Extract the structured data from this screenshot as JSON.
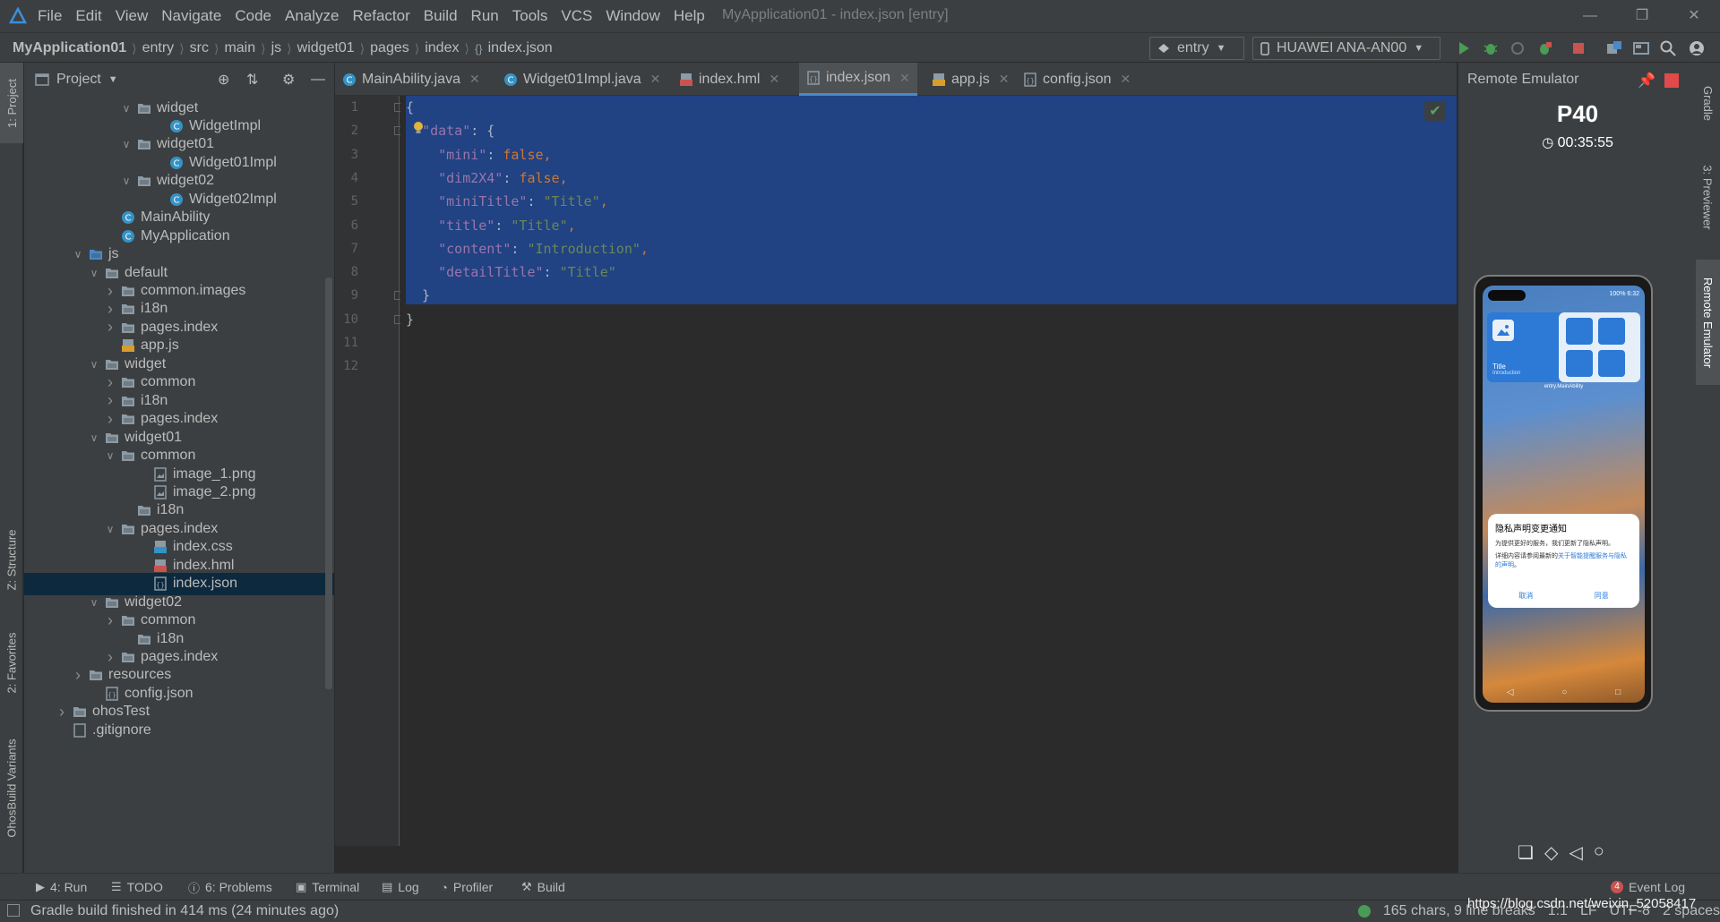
{
  "menubar": {
    "items": [
      "File",
      "Edit",
      "View",
      "Navigate",
      "Code",
      "Analyze",
      "Refactor",
      "Build",
      "Run",
      "Tools",
      "VCS",
      "Window",
      "Help"
    ],
    "window_title": "MyApplication01 - index.json [entry]"
  },
  "breadcrumb": [
    "MyApplication01",
    "entry",
    "src",
    "main",
    "js",
    "widget01",
    "pages",
    "index",
    "index.json"
  ],
  "toolbar": {
    "module_selector": "entry",
    "device_selector": "HUAWEI ANA-AN00"
  },
  "project_panel": {
    "title": "Project",
    "tree": [
      {
        "label": "widget",
        "level": 7,
        "type": "folder",
        "expanded": true
      },
      {
        "label": "WidgetImpl",
        "level": 9,
        "type": "class"
      },
      {
        "label": "widget01",
        "level": 7,
        "type": "folder",
        "expanded": true
      },
      {
        "label": "Widget01Impl",
        "level": 9,
        "type": "class"
      },
      {
        "label": "widget02",
        "level": 7,
        "type": "folder",
        "expanded": true
      },
      {
        "label": "Widget02Impl",
        "level": 9,
        "type": "class"
      },
      {
        "label": "MainAbility",
        "level": 6,
        "type": "class"
      },
      {
        "label": "MyApplication",
        "level": 6,
        "type": "class"
      },
      {
        "label": "js",
        "level": 4,
        "type": "folder-blue",
        "expanded": true
      },
      {
        "label": "default",
        "level": 5,
        "type": "folder",
        "expanded": true
      },
      {
        "label": "common.images",
        "level": 6,
        "type": "folder",
        "expanded": false
      },
      {
        "label": "i18n",
        "level": 6,
        "type": "folder",
        "expanded": false
      },
      {
        "label": "pages.index",
        "level": 6,
        "type": "folder",
        "expanded": false
      },
      {
        "label": "app.js",
        "level": 6,
        "type": "js"
      },
      {
        "label": "widget",
        "level": 5,
        "type": "folder",
        "expanded": true
      },
      {
        "label": "common",
        "level": 6,
        "type": "folder",
        "expanded": false
      },
      {
        "label": "i18n",
        "level": 6,
        "type": "folder",
        "expanded": false
      },
      {
        "label": "pages.index",
        "level": 6,
        "type": "folder",
        "expanded": false
      },
      {
        "label": "widget01",
        "level": 5,
        "type": "folder",
        "expanded": true
      },
      {
        "label": "common",
        "level": 6,
        "type": "folder",
        "expanded": true
      },
      {
        "label": "image_1.png",
        "level": 8,
        "type": "image"
      },
      {
        "label": "image_2.png",
        "level": 8,
        "type": "image"
      },
      {
        "label": "i18n",
        "level": 7,
        "type": "folder"
      },
      {
        "label": "pages.index",
        "level": 6,
        "type": "folder",
        "expanded": true
      },
      {
        "label": "index.css",
        "level": 8,
        "type": "css"
      },
      {
        "label": "index.hml",
        "level": 8,
        "type": "hml"
      },
      {
        "label": "index.json",
        "level": 8,
        "type": "json",
        "selected": true
      },
      {
        "label": "widget02",
        "level": 5,
        "type": "folder",
        "expanded": true
      },
      {
        "label": "common",
        "level": 6,
        "type": "folder",
        "expanded": false
      },
      {
        "label": "i18n",
        "level": 7,
        "type": "folder"
      },
      {
        "label": "pages.index",
        "level": 6,
        "type": "folder",
        "expanded": false
      },
      {
        "label": "resources",
        "level": 4,
        "type": "folder",
        "expanded": false
      },
      {
        "label": "config.json",
        "level": 5,
        "type": "json"
      },
      {
        "label": "ohosTest",
        "level": 3,
        "type": "folder",
        "expanded": false
      },
      {
        "label": ".gitignore",
        "level": 3,
        "type": "file"
      }
    ]
  },
  "editor_tabs": [
    {
      "label": "MainAbility.java",
      "icon": "class-icon",
      "active": false
    },
    {
      "label": "Widget01Impl.java",
      "icon": "class-icon",
      "active": false
    },
    {
      "label": "index.hml",
      "icon": "hml-icon",
      "active": false
    },
    {
      "label": "index.json",
      "icon": "json-icon",
      "active": true
    },
    {
      "label": "app.js",
      "icon": "js-icon",
      "active": false
    },
    {
      "label": "config.json",
      "icon": "json-icon",
      "active": false
    }
  ],
  "editor": {
    "line_numbers": [
      "1",
      "2",
      "3",
      "4",
      "5",
      "6",
      "7",
      "8",
      "9",
      "10",
      "11",
      "12"
    ],
    "lines": [
      [
        {
          "t": "{",
          "c": "p"
        }
      ],
      [
        {
          "t": "  ",
          "c": "p"
        },
        {
          "t": "\"data\"",
          "c": "k"
        },
        {
          "t": ": {",
          "c": "p"
        }
      ],
      [
        {
          "t": "    ",
          "c": "p"
        },
        {
          "t": "\"mini\"",
          "c": "k"
        },
        {
          "t": ": ",
          "c": "p"
        },
        {
          "t": "false",
          "c": "kw"
        },
        {
          "t": ",",
          "c": "kw"
        }
      ],
      [
        {
          "t": "    ",
          "c": "p"
        },
        {
          "t": "\"dim2X4\"",
          "c": "k"
        },
        {
          "t": ": ",
          "c": "p"
        },
        {
          "t": "false",
          "c": "kw"
        },
        {
          "t": ",",
          "c": "kw"
        }
      ],
      [
        {
          "t": "    ",
          "c": "p"
        },
        {
          "t": "\"miniTitle\"",
          "c": "k"
        },
        {
          "t": ": ",
          "c": "p"
        },
        {
          "t": "\"Title\"",
          "c": "s"
        },
        {
          "t": ",",
          "c": "kw"
        }
      ],
      [
        {
          "t": "    ",
          "c": "p"
        },
        {
          "t": "\"title\"",
          "c": "k"
        },
        {
          "t": ": ",
          "c": "p"
        },
        {
          "t": "\"Title\"",
          "c": "s"
        },
        {
          "t": ",",
          "c": "kw"
        }
      ],
      [
        {
          "t": "    ",
          "c": "p"
        },
        {
          "t": "\"content\"",
          "c": "k"
        },
        {
          "t": ": ",
          "c": "p"
        },
        {
          "t": "\"Introduction\"",
          "c": "s"
        },
        {
          "t": ",",
          "c": "kw"
        }
      ],
      [
        {
          "t": "    ",
          "c": "p"
        },
        {
          "t": "\"detailTitle\"",
          "c": "k"
        },
        {
          "t": ": ",
          "c": "p"
        },
        {
          "t": "\"Title\"",
          "c": "s"
        }
      ],
      [
        {
          "t": "  }",
          "c": "p"
        }
      ],
      [
        {
          "t": "}",
          "c": "p"
        }
      ],
      [],
      []
    ]
  },
  "remote_emulator": {
    "title": "Remote Emulator",
    "model": "P40",
    "timer": "00:35:55",
    "phone": {
      "status_right": "100% 6:32",
      "widget_title": "Title",
      "widget_subtitle": "Introduction",
      "widget_caption": "entry.MainAbility",
      "dialog_title": "隐私声明变更通知",
      "dialog_body": "为提供更好的服务，我们更新了隐私声明。",
      "dialog_body2_prefix": "详细内容请参阅最新的",
      "dialog_body2_link": "关于智能提醒服务与隐私的声明",
      "dialog_body2_suffix": "。",
      "dialog_cancel": "取消",
      "dialog_agree": "同意"
    }
  },
  "left_stripe": [
    "1: Project",
    "Z: Structure",
    "2: Favorites",
    "OhosBuild Variants"
  ],
  "right_stripe": [
    "Gradle",
    "3: Previewer",
    "Remote Emulator"
  ],
  "tool_windows": [
    {
      "label": "4: Run",
      "icon": "run-icon"
    },
    {
      "label": "TODO",
      "icon": "todo-icon"
    },
    {
      "label": "6: Problems",
      "icon": "problems-icon"
    },
    {
      "label": "Terminal",
      "icon": "terminal-icon"
    },
    {
      "label": "Log",
      "icon": "log-icon"
    },
    {
      "label": "Profiler",
      "icon": "profiler-icon"
    },
    {
      "label": "Build",
      "icon": "build-icon"
    }
  ],
  "event_log": {
    "count": "4",
    "label": "Event Log"
  },
  "status_bar": {
    "message": "Gradle build finished in 414 ms (24 minutes ago)",
    "chars": "165 chars, 9 line breaks",
    "position": "1:1",
    "line_sep": "LF",
    "encoding": "UTF-8",
    "indent": "2 spaces"
  },
  "watermark": "https://blog.csdn.net/weixin_52058417",
  "colors": {
    "bg": "#2b2b2b",
    "panel": "#3c3f41",
    "selection": "#214283",
    "accent": "#4a88c7",
    "json_key": "#9876aa",
    "json_string": "#6a8759",
    "json_keyword": "#cc7832"
  }
}
